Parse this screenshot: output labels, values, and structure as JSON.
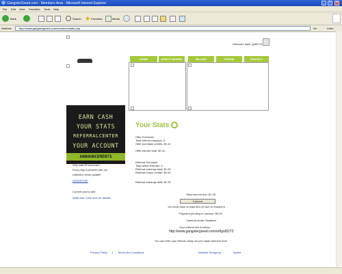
{
  "window": {
    "title": "GangsterGreed.com - Members Area - Microsoft Internet Explorer"
  },
  "menu": [
    "File",
    "Edit",
    "View",
    "Favorites",
    "Tools",
    "Help"
  ],
  "toolbar": {
    "back": "Back",
    "search": "Search",
    "favorites": "Favorites",
    "media": "Media"
  },
  "address": {
    "label": "Address",
    "url": "http://www.gangstergreed.com/members/stats.php",
    "go": "Go",
    "links": "Links"
  },
  "header": {
    "welcome": "Welcome back, grd5273"
  },
  "nav": [
    "HOME",
    "HOW IT WORKS",
    "BILLING",
    "FORUM",
    "CONTACT"
  ],
  "promo": {
    "lines": [
      "EARN CASH",
      "YOUR STATS",
      "REFERRALCENTER",
      "YOUR ACCOUNT"
    ],
    "announcements": "ANNOUNCEMENTS"
  },
  "announcements": [
    "Why wait 30 seconds?",
    "Every day 5 pennies with our",
    "collection news update!",
    "ADVERTISE"
  ],
  "sidebar": {
    "line1": "Current promo site:",
    "line2": "Write Ads: Click here for details"
  },
  "stats": {
    "title": "Your Stats",
    "offers_header": "Offer Purchase",
    "offers": [
      "Total referred signups: 5",
      "Offer purchase credits: $0.10"
    ],
    "offer_earned": "Offer earned total: $0.10",
    "referral_header": "Referral Purchase",
    "referral": [
      "Total direct referrals: 0",
      "Referral earnings total: $1.25",
      "Referral bonus credits: $0.00"
    ],
    "referral_earned": "Referral earnings total: $1.25",
    "total_amount": "Total amount due: $1.35",
    "cashout_button": "Cashout",
    "min_note": "You must have at least $10.00 due to request $",
    "pending": "Payment pending in cashout: $0.00",
    "cashout_note": "Cashout mode: Disabled",
    "ref_link_label": "Your referral link is below:",
    "ref_link": "http://www.gangstergreed.com/ref/grd5273",
    "upgrade_note": "You can refer your friends using our pre-made banners here"
  },
  "footer": {
    "privacy": "Privacy Policy",
    "sep": "|",
    "terms": "Terms and Conditions",
    "website": "Website Design by",
    "credit": "Sytekt"
  }
}
